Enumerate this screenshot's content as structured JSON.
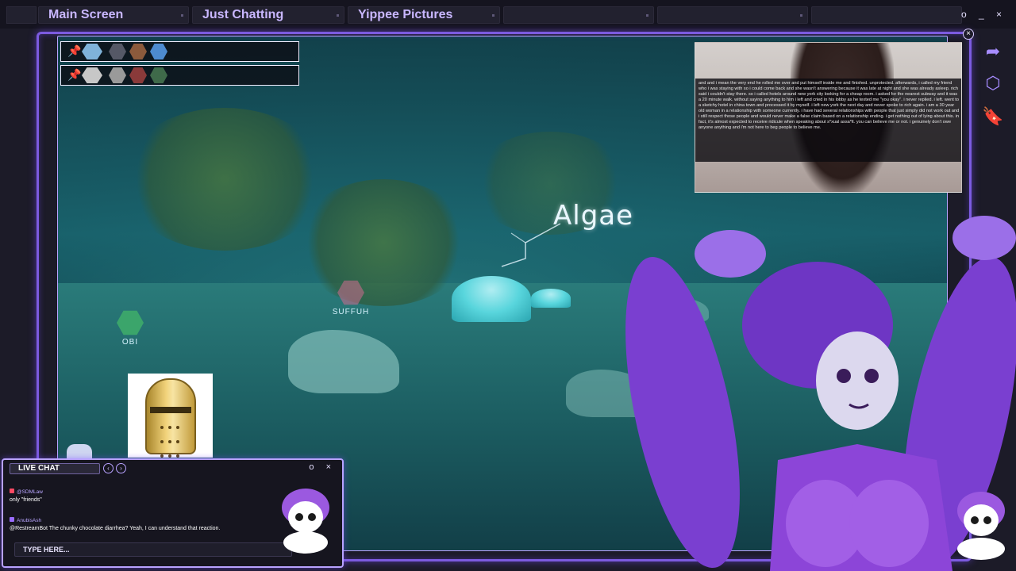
{
  "tabs": [
    {
      "label": "Main Screen"
    },
    {
      "label": "Just Chatting"
    },
    {
      "label": "Yippee Pictures"
    },
    {
      "label": ""
    },
    {
      "label": ""
    },
    {
      "label": ""
    }
  ],
  "window_controls": "o _ ×",
  "game": {
    "location_label": "Algae",
    "players": [
      {
        "name": "SUFFUH",
        "color": "#d06b8f"
      },
      {
        "name": "OBI",
        "color": "#3fae6a"
      }
    ]
  },
  "clip": {
    "caption": "and and i mean the very end he rolled me over and put himself inside me and finished. unprotected. afterwards, i called my friend who i was staying with so i could come back and she wasn't answering because it was late at night and she was already asleep. rich said i couldn't stay there. so i called hotels around new york city looking for a cheap room. i asked for the nearest subway and it was a 20 minute walk. without saying anything to him i left and cried in his lobby as he texted me \"you okay\". i never replied. i left. went to a sketchy hotel in china town and processed it by myself. i left new york the next day and never spoke to rich again. i am a 30 year old woman in a relationship with someone currently. i have had several relationships with people that just simply did not work out and i still respect those people and would never make a false claim based on a relationship ending. i get nothing out of lying about this. in fact, it's almost expected to receive ridicule when speaking about s*xual assa*lt. you can believe me or not. i genuinely don't owe anyone anything and i'm not here to beg people to believe me."
  },
  "chat": {
    "title": "LIVE CHAT",
    "window_controls": "o ×",
    "messages": [
      {
        "user": "@SDMLaw",
        "text": "only \"friends\""
      },
      {
        "user": "AnubisAsh",
        "text": "@RestreamBot The chunky chocolate diarrhea? Yeah, I can understand that reaction."
      }
    ],
    "input_placeholder": "TYPE HERE..."
  },
  "colors": {
    "accent": "#7c5be0",
    "frame_glow": "#b9a3ff",
    "tab_text": "#c9b7ff"
  },
  "icons": [
    "share-icon",
    "shield-icon",
    "bookmark-icon",
    "pin-icon",
    "close-icon",
    "chevron-left-icon",
    "chevron-right-icon"
  ]
}
